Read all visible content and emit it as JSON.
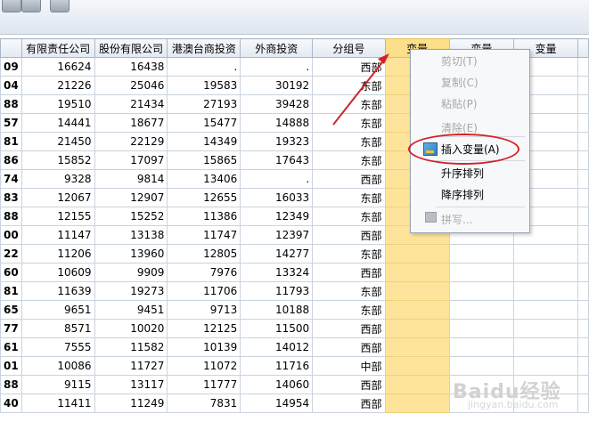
{
  "table": {
    "columns": [
      "有限责任公司",
      "股份有限公司",
      "港澳台商投资",
      "外商投资",
      "分组号",
      "变量",
      "变量",
      "变量"
    ],
    "rows": [
      {
        "id": "09",
        "c1": "16624",
        "c2": "16438",
        "c3": ".",
        "c4": ".",
        "g": "西部"
      },
      {
        "id": "04",
        "c1": "21226",
        "c2": "25046",
        "c3": "19583",
        "c4": "30192",
        "g": "东部"
      },
      {
        "id": "88",
        "c1": "19510",
        "c2": "21434",
        "c3": "27193",
        "c4": "39428",
        "g": "东部"
      },
      {
        "id": "57",
        "c1": "14441",
        "c2": "18677",
        "c3": "15477",
        "c4": "14888",
        "g": "东部"
      },
      {
        "id": "81",
        "c1": "21450",
        "c2": "22129",
        "c3": "14349",
        "c4": "19323",
        "g": "东部"
      },
      {
        "id": "86",
        "c1": "15852",
        "c2": "17097",
        "c3": "15865",
        "c4": "17643",
        "g": "东部"
      },
      {
        "id": "74",
        "c1": "9328",
        "c2": "9814",
        "c3": "13406",
        "c4": ".",
        "g": "西部"
      },
      {
        "id": "83",
        "c1": "12067",
        "c2": "12907",
        "c3": "12655",
        "c4": "16033",
        "g": "东部"
      },
      {
        "id": "88",
        "c1": "12155",
        "c2": "15252",
        "c3": "11386",
        "c4": "12349",
        "g": "东部"
      },
      {
        "id": "00",
        "c1": "11147",
        "c2": "13138",
        "c3": "11747",
        "c4": "12397",
        "g": "西部"
      },
      {
        "id": "22",
        "c1": "11206",
        "c2": "13960",
        "c3": "12805",
        "c4": "14277",
        "g": "东部"
      },
      {
        "id": "60",
        "c1": "10609",
        "c2": "9909",
        "c3": "7976",
        "c4": "13324",
        "g": "西部"
      },
      {
        "id": "81",
        "c1": "11639",
        "c2": "19273",
        "c3": "11706",
        "c4": "11793",
        "g": "东部"
      },
      {
        "id": "65",
        "c1": "9651",
        "c2": "9451",
        "c3": "9713",
        "c4": "10188",
        "g": "东部"
      },
      {
        "id": "77",
        "c1": "8571",
        "c2": "10020",
        "c3": "12125",
        "c4": "11500",
        "g": "西部"
      },
      {
        "id": "61",
        "c1": "7555",
        "c2": "11582",
        "c3": "10139",
        "c4": "14012",
        "g": "西部"
      },
      {
        "id": "01",
        "c1": "10086",
        "c2": "11727",
        "c3": "11072",
        "c4": "11716",
        "g": "中部"
      },
      {
        "id": "88",
        "c1": "9115",
        "c2": "13117",
        "c3": "11777",
        "c4": "14060",
        "g": "西部"
      },
      {
        "id": "40",
        "c1": "11411",
        "c2": "11249",
        "c3": "7831",
        "c4": "14954",
        "g": "西部"
      }
    ]
  },
  "context_menu": {
    "cut": "剪切(T)",
    "copy": "复制(C)",
    "paste": "粘贴(P)",
    "clear": "清除(E)",
    "insert_variable": "插入变量(A)",
    "sort_ascending": "升序排列",
    "sort_descending": "降序排列",
    "spelling": "拼写..."
  },
  "watermark": {
    "logo": "Baidu经验",
    "url": "jingyan.baidu.com"
  },
  "colors": {
    "selected_column": "#fde49a",
    "annotation_red": "#d2232a"
  }
}
